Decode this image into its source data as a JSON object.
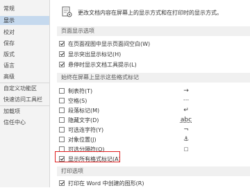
{
  "sidebar": {
    "items": [
      {
        "label": "常规"
      },
      {
        "label": "显示",
        "selected": true
      },
      {
        "label": "校对"
      },
      {
        "label": "保存"
      },
      {
        "label": "版式"
      },
      {
        "label": "语言"
      },
      {
        "label": "高级"
      },
      {
        "label": "自定义功能区"
      },
      {
        "label": "快速访问工具栏"
      },
      {
        "label": "加载项"
      },
      {
        "label": "信任中心"
      }
    ]
  },
  "main": {
    "description": "更改文档内容在屏幕上的显示方式和在打印时的显示方式。",
    "description_icon": "document-display-icon",
    "page_display": {
      "header": "页面显示选项",
      "options": [
        {
          "label": "在页面视图中显示页面间空白(W)",
          "checked": true
        },
        {
          "label": "显示突出显示标记(H)",
          "checked": true
        },
        {
          "label": "悬停时显示文档工具提示(L)",
          "checked": true
        }
      ]
    },
    "format_marks": {
      "header": "始终在屏幕上显示这些格式标记",
      "options": [
        {
          "label": "制表符(T)",
          "checked": false,
          "mark": "→"
        },
        {
          "label": "空格(S)",
          "checked": false,
          "mark": "···"
        },
        {
          "label": "段落标记(M)",
          "checked": false,
          "mark": "↵"
        },
        {
          "label": "隐藏文字(D)",
          "checked": false,
          "mark": "abc"
        },
        {
          "label": "可选连字符(Y)",
          "checked": false,
          "mark": "¬"
        },
        {
          "label": "对象位置(J)",
          "checked": false,
          "mark": "⚓"
        },
        {
          "label": "可选分隔符(O)",
          "checked": false,
          "mark": "□"
        },
        {
          "label": "显示所有格式标记(A)",
          "checked": true,
          "mark": ""
        }
      ]
    },
    "print": {
      "header": "打印选项",
      "options": [
        {
          "label": "打印在 Word 中创建的图形(R)",
          "checked": true
        }
      ]
    }
  }
}
